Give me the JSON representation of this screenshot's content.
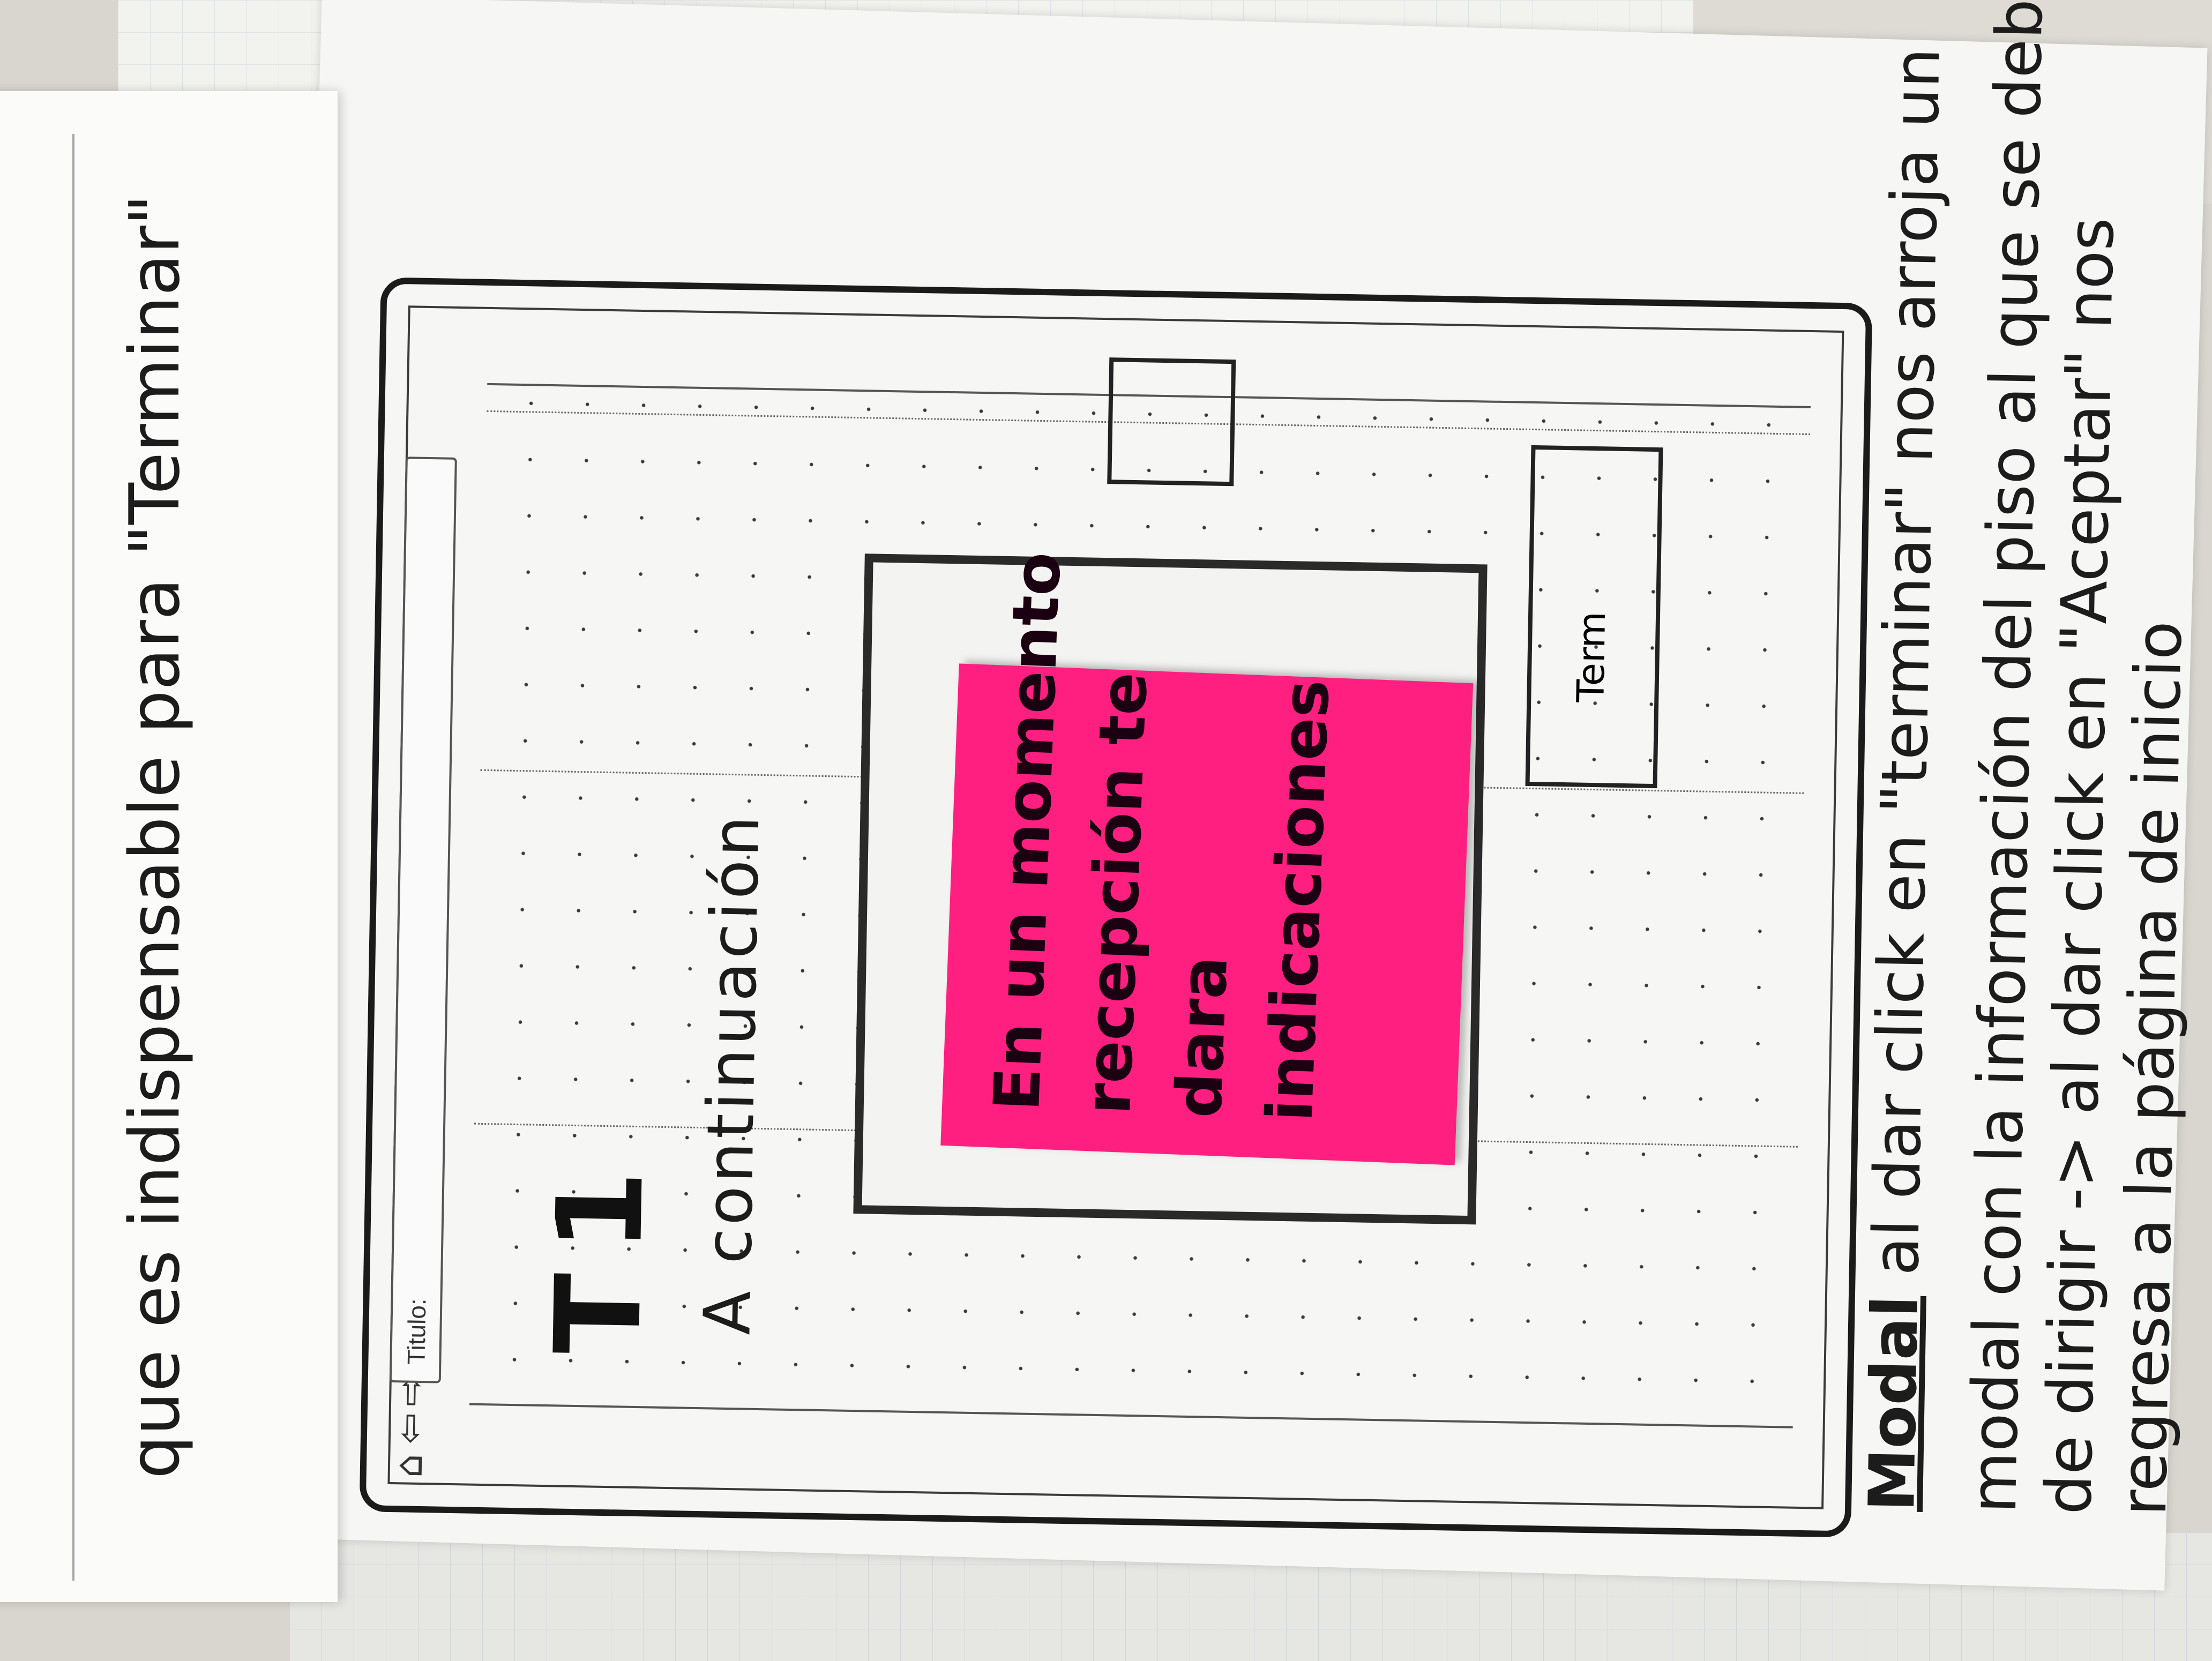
{
  "left_note": {
    "line": "que es indispensable para \"Terminar\""
  },
  "mockup": {
    "title_field_label": "Titulo:",
    "nav_icons": [
      "home-icon",
      "back-arrow-icon",
      "forward-arrow-icon"
    ],
    "screen_heading": "T1",
    "content_line": "A continuación",
    "button_label": "Term"
  },
  "sticky_note": {
    "lines": [
      "En un momento",
      "recepción te",
      "dara",
      "indicaciones"
    ],
    "color": "#ff1f80"
  },
  "annotation": {
    "label": "Modal",
    "lines": [
      "al dar click en \"terminar\" nos arroja un",
      "modal con la información del piso al que se debe",
      "de dirigir -> al dar click en \"Aceptar\" nos",
      "regresa a la página de inicio"
    ]
  }
}
